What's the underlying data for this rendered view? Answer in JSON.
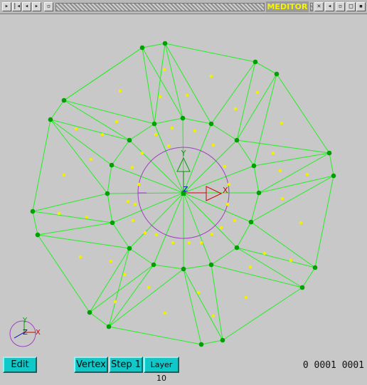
{
  "window": {
    "title": "MEDITOR"
  },
  "toolbar": {
    "edit_label": "Edit",
    "vertex_label": "Vertex",
    "step_label": "Step 1",
    "layer_label": "Layer 10"
  },
  "status": {
    "text": "0 0001 0001"
  },
  "axis_labels": {
    "x": "X",
    "y": "Y",
    "z": "Z"
  },
  "colors": {
    "edges": "#22ee22",
    "vertices": "#00a000",
    "centers": "#f0f000",
    "circle": "#a040c0",
    "gizmo_x": "#d00000",
    "gizmo_y": "#00a000",
    "gizmo_z": "#0000c0"
  }
}
